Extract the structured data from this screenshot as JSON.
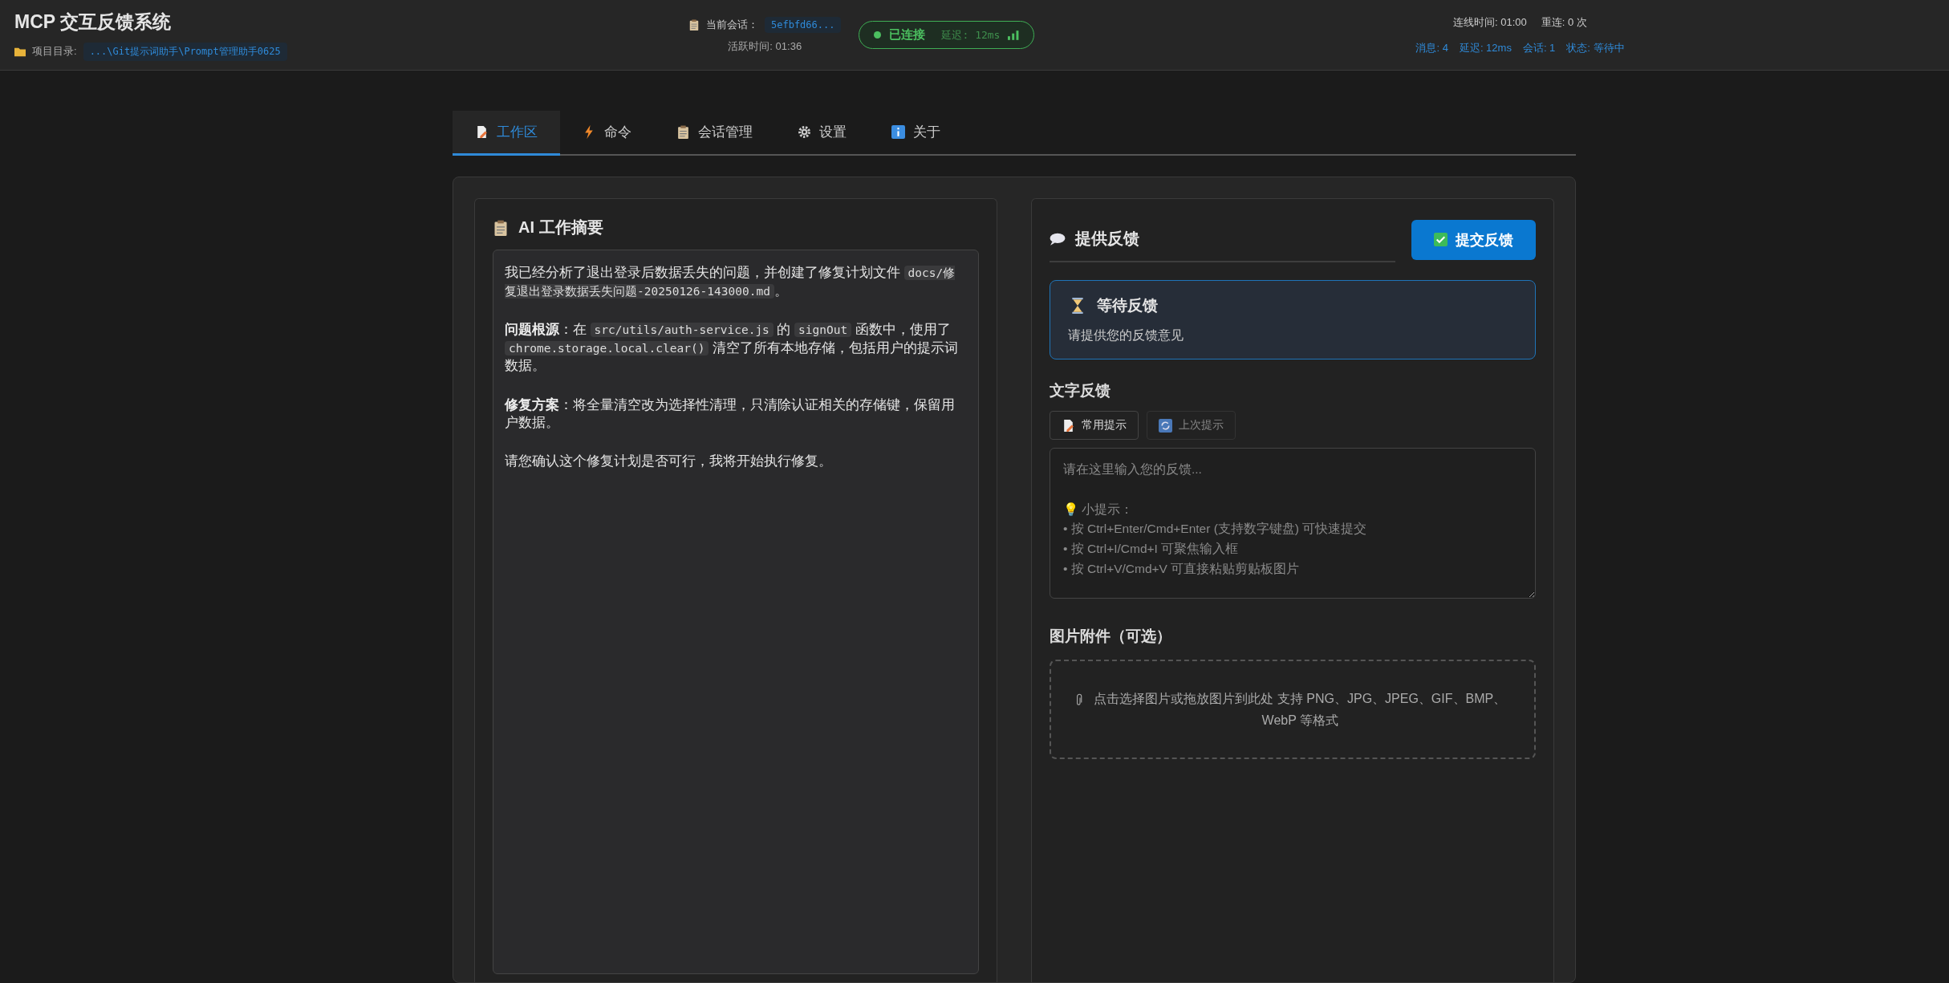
{
  "header": {
    "title": "MCP 交互反馈系统",
    "project_label": "项目目录:",
    "project_path": "...\\Git提示词助手\\Prompt管理助手0625",
    "session_label": "当前会话：",
    "session_id": "5efbfd66...",
    "active_time": "活跃时间: 01:36",
    "connection": {
      "connected": true,
      "label": "已连接",
      "latency": "延迟: 12ms"
    },
    "uptime": "连线时间: 01:00",
    "reconnects": "重连: 0 次",
    "stats": [
      {
        "label": "消息:",
        "value": "4"
      },
      {
        "label": "延迟:",
        "value": "12ms"
      },
      {
        "label": "会话:",
        "value": "1"
      },
      {
        "label": "状态:",
        "value": "等待中"
      }
    ]
  },
  "tabs": [
    {
      "label": "工作区",
      "kind": "doc",
      "selected": true
    },
    {
      "label": "命令",
      "kind": "bolt",
      "selected": false
    },
    {
      "label": "会话管理",
      "kind": "clipboard",
      "selected": false
    },
    {
      "label": "设置",
      "kind": "gear",
      "selected": false
    },
    {
      "label": "关于",
      "kind": "info",
      "selected": false
    }
  ],
  "summary": {
    "title": "AI 工作摘要",
    "paragraphs": [
      [
        {
          "kind": "text",
          "text": "我已经分析了退出登录后数据丢失的问题，并创建了修复计划文件 "
        },
        {
          "kind": "code",
          "text": "docs/修复退出登录数据丢失问题-20250126-143000.md"
        },
        {
          "kind": "text",
          "text": "。"
        }
      ],
      [
        {
          "kind": "bold",
          "text": "问题根源"
        },
        {
          "kind": "text",
          "text": "：在 "
        },
        {
          "kind": "code",
          "text": "src/utils/auth-service.js"
        },
        {
          "kind": "text",
          "text": " 的 "
        },
        {
          "kind": "code",
          "text": "signOut"
        },
        {
          "kind": "text",
          "text": " 函数中，使用了 "
        },
        {
          "kind": "code",
          "text": "chrome.storage.local.clear()"
        },
        {
          "kind": "text",
          "text": " 清空了所有本地存储，包括用户的提示词数据。"
        }
      ],
      [
        {
          "kind": "bold",
          "text": "修复方案"
        },
        {
          "kind": "text",
          "text": "：将全量清空改为选择性清理，只清除认证相关的存储键，保留用户数据。"
        }
      ],
      [
        {
          "kind": "text",
          "text": "请您确认这个修复计划是否可行，我将开始执行修复。"
        }
      ]
    ]
  },
  "feedback": {
    "title": "提供反馈",
    "submit_button": "提交反馈",
    "status": {
      "title": "等待反馈",
      "message": "请提供您的反馈意见"
    },
    "text_section": "文字反馈",
    "prompt_buttons": [
      {
        "label": "常用提示",
        "kind": "doc",
        "disabled": false
      },
      {
        "label": "上次提示",
        "kind": "refresh",
        "disabled": true
      }
    ],
    "placeholder": "请在这里输入您的反馈...\n\n💡 小提示：\n• 按 Ctrl+Enter/Cmd+Enter (支持数字键盘) 可快速提交\n• 按 Ctrl+I/Cmd+I 可聚焦输入框\n• 按 Ctrl+V/Cmd+V 可直接粘贴剪贴板图片",
    "image_section": "图片附件（可选）",
    "dropzone": "点击选择图片或拖放图片到此处 支持 PNG、JPG、JPEG、GIF、BMP、WebP 等格式"
  }
}
